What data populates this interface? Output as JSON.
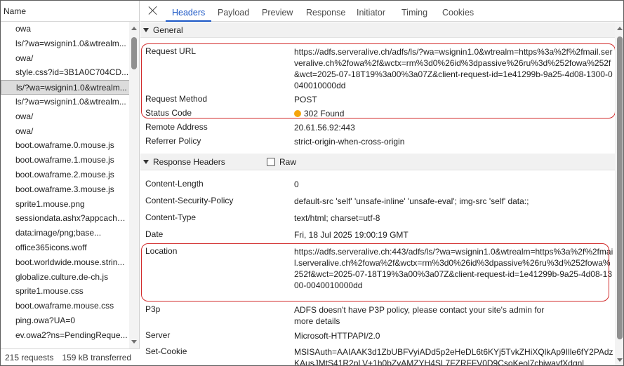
{
  "left": {
    "column_header": "Name",
    "requests": [
      {
        "name": "owa"
      },
      {
        "name": "ls/?wa=wsignin1.0&wtrealm..."
      },
      {
        "name": "owa/"
      },
      {
        "name": "style.css?id=3B1A0C704CD..."
      },
      {
        "name": "ls/?wa=wsignin1.0&wtrealm..."
      },
      {
        "name": "ls/?wa=wsignin1.0&wtrealm..."
      },
      {
        "name": "owa/"
      },
      {
        "name": "owa/"
      },
      {
        "name": "boot.owaframe.0.mouse.js"
      },
      {
        "name": "boot.owaframe.1.mouse.js"
      },
      {
        "name": "boot.owaframe.2.mouse.js"
      },
      {
        "name": "boot.owaframe.3.mouse.js"
      },
      {
        "name": "sprite1.mouse.png"
      },
      {
        "name": "sessiondata.ashx?appcachec..."
      },
      {
        "name": "data:image/png;base..."
      },
      {
        "name": "office365icons.woff"
      },
      {
        "name": "boot.worldwide.mouse.strin..."
      },
      {
        "name": "globalize.culture.de-ch.js"
      },
      {
        "name": "sprite1.mouse.css"
      },
      {
        "name": "boot.owaframe.mouse.css"
      },
      {
        "name": "ping.owa?UA=0"
      },
      {
        "name": "ev.owa2?ns=PendingReque..."
      }
    ],
    "selected_index": 4,
    "footer": {
      "requests": "215 requests",
      "transferred": "159 kB transferred",
      "extra": "1"
    }
  },
  "tabs": [
    "Headers",
    "Payload",
    "Preview",
    "Response",
    "Initiator",
    "Timing",
    "Cookies"
  ],
  "active_tab": "Headers",
  "general": {
    "title": "General",
    "rows": [
      {
        "key": "Request URL",
        "value": "https://adfs.serveralive.ch/adfs/ls/?wa=wsignin1.0&wtrealm=https%3a%2f%2fmail.serveralive.ch%2fowa%2f&wctx=rm%3d0%26id%3dpassive%26ru%3d%252fowa%252f&wct=2025-07-18T19%3a00%3a07Z&client-request-id=1e41299b-9a25-4d08-1300-0040010000dd"
      },
      {
        "key": "Request Method",
        "value": "POST"
      },
      {
        "key": "Status Code",
        "value": "302 Found"
      },
      {
        "key": "Remote Address",
        "value": "20.61.56.92:443"
      },
      {
        "key": "Referrer Policy",
        "value": "strict-origin-when-cross-origin"
      }
    ],
    "status_color": "#f5a50a"
  },
  "response_headers": {
    "title": "Response Headers",
    "raw_label": "Raw",
    "rows": [
      {
        "key": "Content-Length",
        "value": "0"
      },
      {
        "key": "Content-Security-Policy",
        "value": "default-src 'self' 'unsafe-inline' 'unsafe-eval'; img-src 'self' data:;"
      },
      {
        "key": "Content-Type",
        "value": "text/html; charset=utf-8"
      },
      {
        "key": "Date",
        "value": "Fri, 18 Jul 2025 19:00:19 GMT"
      },
      {
        "key": "Location",
        "value": "https://adfs.serveralive.ch:443/adfs/ls/?wa=wsignin1.0&wtrealm=https%3a%2f%2fmail.serveralive.ch%2fowa%2f&wctx=rm%3d0%26id%3dpassive%26ru%3d%252fowa%252f&wct=2025-07-18T19%3a00%3a07Z&client-request-id=1e41299b-9a25-4d08-1300-0040010000dd"
      },
      {
        "key": "P3p",
        "value": "ADFS doesn't have P3P policy, please contact your site's admin for more details"
      },
      {
        "key": "Server",
        "value": "Microsoft-HTTPAPI/2.0"
      },
      {
        "key": "Set-Cookie",
        "value": "MSISAuth=AAIAAK3d1ZbUBFVyiADd5p2eHeDL6t6KYj5TvkZHiXQlkAp9Ille6fY2PAdzKAusJMtS41R2pLV+1h0bZvAMZYH4SL7FZRFFV0D9CsoKeol7cbiwavfXdqnl"
      }
    ]
  },
  "highlight_color": "#d12a2a",
  "accent_color": "#1a56c5"
}
